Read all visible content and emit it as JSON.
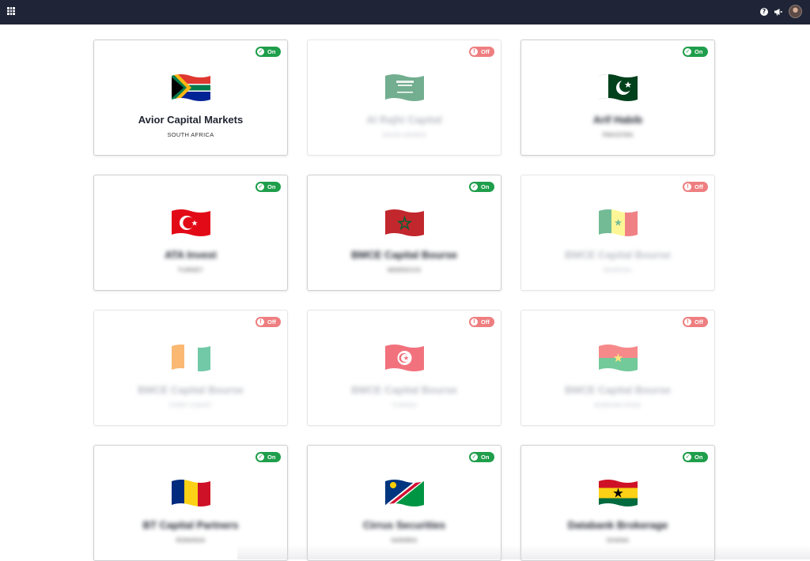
{
  "header": {
    "apps_icon": "grid-apps-icon",
    "help_icon": "question-circle-icon",
    "help_glyph": "?",
    "announce_icon": "megaphone-icon",
    "avatar_icon": "user-avatar"
  },
  "colors": {
    "topbar": "#1f2537",
    "on": "#1f9e4b",
    "off": "#ee7e80"
  },
  "toggle_labels": {
    "on": "On",
    "off": "Off"
  },
  "cards": [
    {
      "name": "Avior Capital Markets",
      "country": "SOUTH AFRICA",
      "status": "on",
      "toggle": "On",
      "flag": "south-africa-flag"
    },
    {
      "name": "Al Rajhi Capital",
      "country": "SAUDI ARABIA",
      "status": "off",
      "toggle": "Off",
      "flag": "saudi-arabia-flag"
    },
    {
      "name": "Arif Habib",
      "country": "PAKISTAN",
      "status": "on",
      "toggle": "On",
      "flag": "pakistan-flag"
    },
    {
      "name": "ATA Invest",
      "country": "TURKEY",
      "status": "on",
      "toggle": "On",
      "flag": "turkey-flag"
    },
    {
      "name": "BMCE Capital Bourse",
      "country": "MOROCCO",
      "status": "on",
      "toggle": "On",
      "flag": "morocco-flag"
    },
    {
      "name": "BMCE Capital Bourse",
      "country": "SENEGAL",
      "status": "off",
      "toggle": "Off",
      "flag": "senegal-flag"
    },
    {
      "name": "BMCE Capital Bourse",
      "country": "IVORY COAST",
      "status": "off",
      "toggle": "Off",
      "flag": "ivory-coast-flag"
    },
    {
      "name": "BMCE Capital Bourse",
      "country": "TUNISIA",
      "status": "off",
      "toggle": "Off",
      "flag": "tunisia-flag"
    },
    {
      "name": "BMCE Capital Bourse",
      "country": "BURKINA FASO",
      "status": "off",
      "toggle": "Off",
      "flag": "burkina-faso-flag"
    },
    {
      "name": "BT Capital Partners",
      "country": "ROMANIA",
      "status": "on",
      "toggle": "On",
      "flag": "romania-flag"
    },
    {
      "name": "Cirrus Securities",
      "country": "NAMIBIA",
      "status": "on",
      "toggle": "On",
      "flag": "namibia-flag"
    },
    {
      "name": "Databank Brokerage",
      "country": "GHANA",
      "status": "on",
      "toggle": "On",
      "flag": "ghana-flag"
    }
  ]
}
